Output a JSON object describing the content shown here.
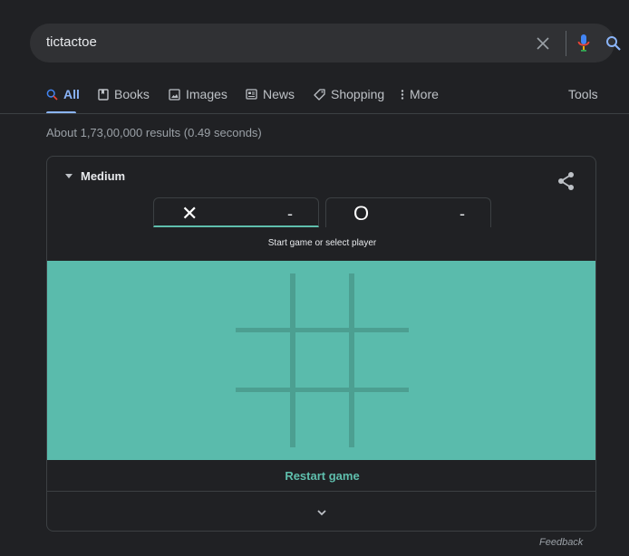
{
  "search": {
    "query": "tictactoe",
    "clear_icon": "close-icon",
    "mic_icon": "microphone-icon",
    "search_icon": "search-icon"
  },
  "tabs": [
    {
      "label": "All",
      "icon": "search-icon",
      "active": true
    },
    {
      "label": "Books",
      "icon": "book-icon"
    },
    {
      "label": "Images",
      "icon": "image-icon"
    },
    {
      "label": "News",
      "icon": "newspaper-icon"
    },
    {
      "label": "Shopping",
      "icon": "tag-icon"
    },
    {
      "label": "More",
      "icon": "vertical-dots-icon"
    }
  ],
  "tools_label": "Tools",
  "result_stats": "About 1,73,00,000 results (0.49 seconds)",
  "game": {
    "difficulty": "Medium",
    "player_x": {
      "mark": "✕",
      "score": "-"
    },
    "player_o": {
      "mark": "O",
      "score": "-"
    },
    "status": "Start game or select player",
    "restart_label": "Restart game",
    "colors": {
      "board": "#5abbac",
      "accent": "#5fbfad",
      "gridlines": "#4c9f91"
    }
  },
  "feedback_label": "Feedback",
  "colors": {
    "background": "#202124",
    "search_bar": "#303134",
    "active_tab": "#8ab4f8"
  }
}
